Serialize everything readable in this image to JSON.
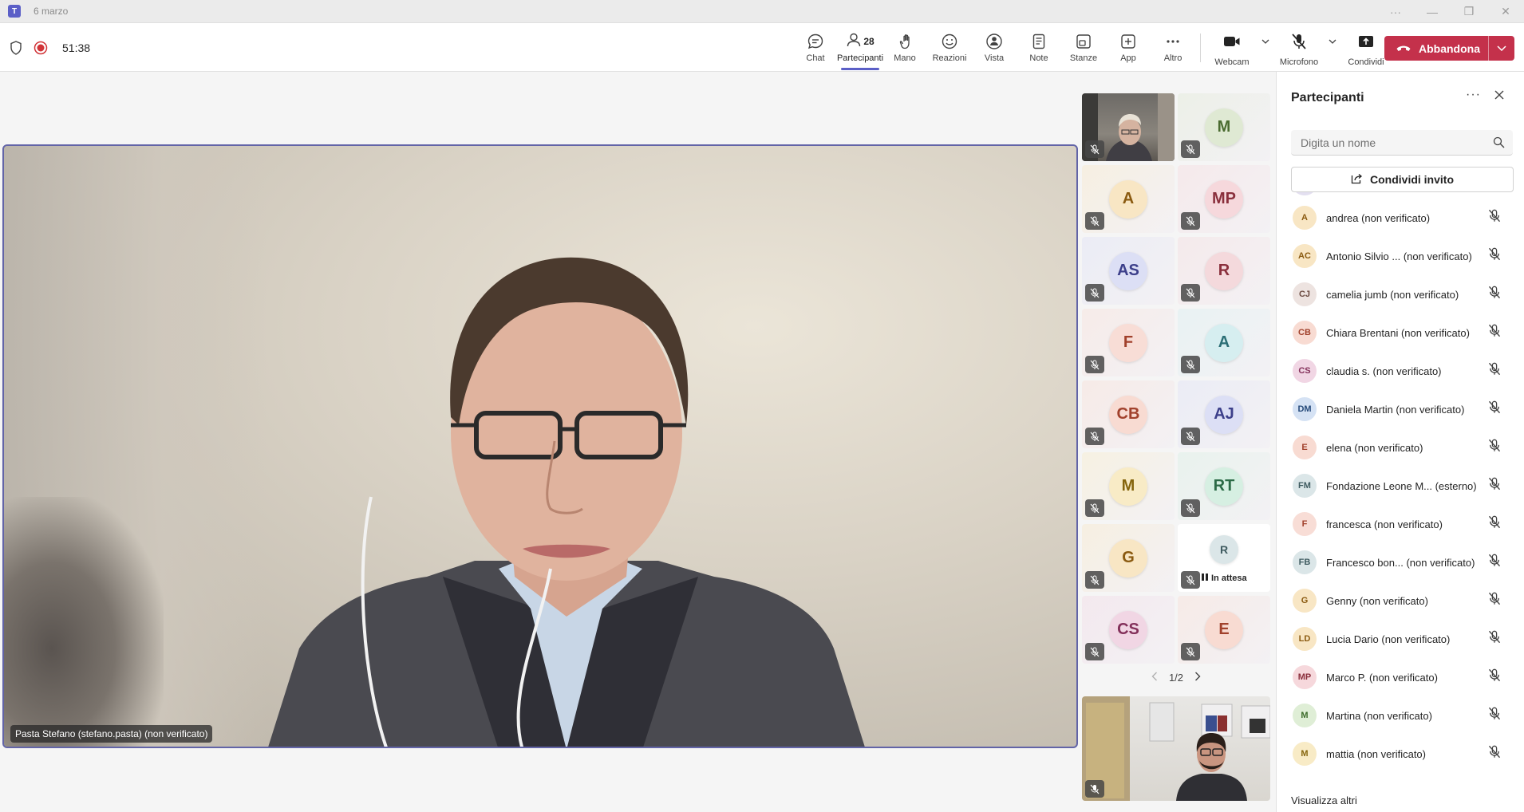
{
  "window": {
    "title": "6 marzo",
    "controls": [
      "···",
      "—",
      "❐",
      "✕"
    ]
  },
  "meeting": {
    "timer": "51:38"
  },
  "toolbar": {
    "buttons": [
      {
        "label": "Chat",
        "icon": "chat-icon"
      },
      {
        "label": "Partecipanti",
        "icon": "people-icon",
        "count": "28",
        "active": true
      },
      {
        "label": "Mano",
        "icon": "raise-hand-icon"
      },
      {
        "label": "Reazioni",
        "icon": "smile-icon"
      },
      {
        "label": "Vista",
        "icon": "view-icon"
      },
      {
        "label": "Note",
        "icon": "notes-icon"
      },
      {
        "label": "Stanze",
        "icon": "rooms-icon"
      },
      {
        "label": "App",
        "icon": "apps-icon"
      },
      {
        "label": "Altro",
        "icon": "more-icon"
      }
    ],
    "webcam_label": "Webcam",
    "mic_label": "Microfono",
    "share_label": "Condividi",
    "leave_label": "Abbandona"
  },
  "main_video": {
    "label": "Pasta Stefano (stefano.pasta) (non verificato)"
  },
  "gallery": {
    "tiles": [
      {
        "type": "video"
      },
      {
        "initials": "M",
        "color": "#dfe9d3",
        "text_color": "#4a6b30"
      },
      {
        "initials": "A",
        "color": "#f8e6c4",
        "text_color": "#8a5a10"
      },
      {
        "initials": "MP",
        "color": "#f6d8dc",
        "text_color": "#8a2f3c"
      },
      {
        "initials": "AS",
        "color": "#dcdff5",
        "text_color": "#3c3f8a"
      },
      {
        "initials": "R",
        "color": "#f4d9dc",
        "text_color": "#8a2f3c"
      },
      {
        "initials": "F",
        "color": "#f8ddd6",
        "text_color": "#a1412c"
      },
      {
        "initials": "A",
        "color": "#d6eef0",
        "text_color": "#2b6e75"
      },
      {
        "initials": "CB",
        "color": "#f8dbd2",
        "text_color": "#a1412c"
      },
      {
        "initials": "AJ",
        "color": "#dcdff5",
        "text_color": "#3c3f8a"
      },
      {
        "initials": "M",
        "color": "#f8ebc6",
        "text_color": "#85650d"
      },
      {
        "initials": "RT",
        "color": "#d6efe2",
        "text_color": "#2c6b47"
      },
      {
        "initials": "G",
        "color": "#f8e6c4",
        "text_color": "#8a5a10"
      },
      {
        "initials": "R",
        "color": "#dbe6e8",
        "text_color": "#3f5b60",
        "status": "In attesa"
      },
      {
        "initials": "CS",
        "color": "#f1d6e4",
        "text_color": "#83305a"
      },
      {
        "initials": "E",
        "color": "#f8dbd2",
        "text_color": "#a1412c"
      }
    ],
    "page": "1/2"
  },
  "panel": {
    "title": "Partecipanti",
    "search_placeholder": "Digita un nome",
    "invite_label": "Condividi invito",
    "participants": [
      {
        "initials": "A",
        "name": "andrea (non verificato)",
        "color": "#f8e6c4",
        "text_color": "#8a5a10"
      },
      {
        "initials": "AC",
        "name": "Antonio Silvio ... (non verificato)",
        "color": "#f8e6c4",
        "text_color": "#8a5a10"
      },
      {
        "initials": "CJ",
        "name": "camelia jumb (non verificato)",
        "color": "#ede3e0",
        "text_color": "#6b4a40"
      },
      {
        "initials": "CB",
        "name": "Chiara Brentani (non verificato)",
        "color": "#f8dbd2",
        "text_color": "#a1412c"
      },
      {
        "initials": "CS",
        "name": "claudia s. (non verificato)",
        "color": "#f1d6e4",
        "text_color": "#83305a"
      },
      {
        "initials": "DM",
        "name": "Daniela Martin (non verificato)",
        "color": "#d5e2f4",
        "text_color": "#254a7a"
      },
      {
        "initials": "E",
        "name": "elena (non verificato)",
        "color": "#f8dbd2",
        "text_color": "#a1412c"
      },
      {
        "initials": "FM",
        "name": "Fondazione Leone M... (esterno)",
        "color": "#dbe6e8",
        "text_color": "#3f5b60"
      },
      {
        "initials": "F",
        "name": "francesca (non verificato)",
        "color": "#f8ddd6",
        "text_color": "#a1412c"
      },
      {
        "initials": "FB",
        "name": "Francesco bon... (non verificato)",
        "color": "#dbe6e8",
        "text_color": "#3f5b60"
      },
      {
        "initials": "G",
        "name": "Genny (non verificato)",
        "color": "#f8e6c4",
        "text_color": "#8a5a10"
      },
      {
        "initials": "LD",
        "name": "Lucia Dario (non verificato)",
        "color": "#f8e6c4",
        "text_color": "#8a5a10"
      },
      {
        "initials": "MP",
        "name": "Marco P. (non verificato)",
        "color": "#f6d8dc",
        "text_color": "#8a2f3c"
      },
      {
        "initials": "M",
        "name": "Martina (non verificato)",
        "color": "#dfeed6",
        "text_color": "#3c6b2a"
      },
      {
        "initials": "M",
        "name": "mattia (non verificato)",
        "color": "#f8ebc6",
        "text_color": "#85650d"
      }
    ],
    "show_more": "Visualizza altri"
  },
  "colors": {
    "accent": "#5b5fc7",
    "leave": "#c4314b",
    "recording": "#d13438"
  }
}
